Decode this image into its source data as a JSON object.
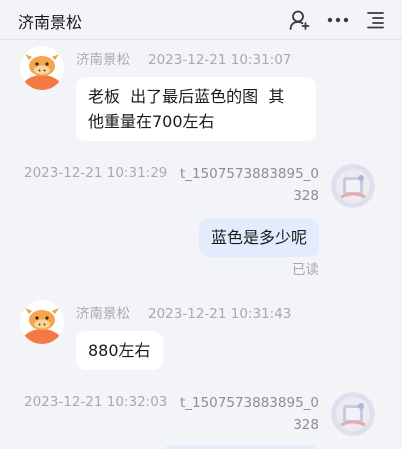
{
  "header": {
    "title": "济南景松",
    "icons": [
      "add-contact-icon",
      "more-icon",
      "menu-icon"
    ]
  },
  "messages": [
    {
      "side": "left",
      "sender": "济南景松",
      "timestamp": "2023-12-21 10:31:07",
      "lines": [
        "老板  出了最后蓝色的图  其",
        "他重量在700左右"
      ]
    },
    {
      "side": "right",
      "sender": "t_1507573883895_0328",
      "timestamp": "2023-12-21 10:31:29",
      "text": "蓝色是多少呢",
      "status": "已读"
    },
    {
      "side": "left",
      "sender": "济南景松",
      "timestamp": "2023-12-21 10:31:43",
      "text": "880左右"
    },
    {
      "side": "right",
      "sender": "t_1507573883895_0328",
      "timestamp": "2023-12-21 10:32:03"
    }
  ],
  "colors": {
    "background": "#f3f4f8",
    "bubble_in": "#ffffff",
    "bubble_out": "#e3ecfd",
    "meta_text": "#a9a9ae",
    "avatar_orange": "#f47a45"
  }
}
